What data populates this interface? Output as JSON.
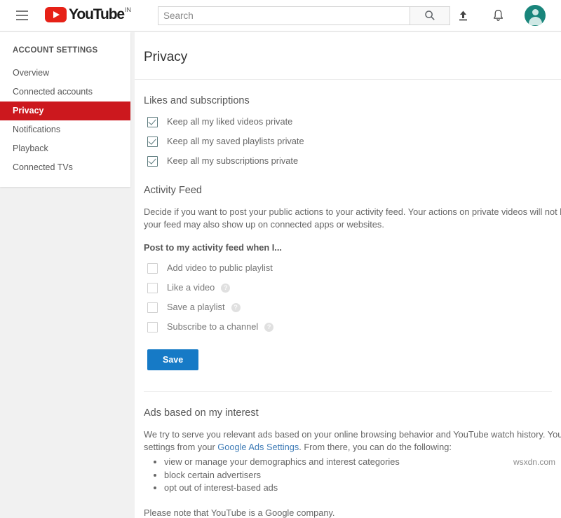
{
  "header": {
    "menu_icon": "hamburger-menu-icon",
    "logo_text": "YouTube",
    "logo_country_code": "IN",
    "search_placeholder": "Search",
    "search_value": "",
    "search_button_icon": "search-icon",
    "upload_icon": "upload-icon",
    "notifications_icon": "bell-icon",
    "avatar_icon": "account-avatar",
    "brand_red": "#e62117",
    "avatar_color": "#19857b"
  },
  "sidebar": {
    "heading": "ACCOUNT SETTINGS",
    "active_color": "#cc181e",
    "items": [
      {
        "label": "Overview",
        "active": false
      },
      {
        "label": "Connected accounts",
        "active": false
      },
      {
        "label": "Privacy",
        "active": true
      },
      {
        "label": "Notifications",
        "active": false
      },
      {
        "label": "Playback",
        "active": false
      },
      {
        "label": "Connected TVs",
        "active": false
      }
    ]
  },
  "main": {
    "page_title": "Privacy",
    "likes_section": {
      "title": "Likes and subscriptions",
      "checkboxes": [
        {
          "label": "Keep all my liked videos private",
          "checked": true
        },
        {
          "label": "Keep all my saved playlists private",
          "checked": true
        },
        {
          "label": "Keep all my subscriptions private",
          "checked": true
        }
      ]
    },
    "activity_section": {
      "title": "Activity Feed",
      "description": "Decide if you want to post your public actions to your activity feed. Your actions on private videos will not be posted. Your actions on your feed may also show up on connected apps or websites.",
      "sub_label": "Post to my activity feed when I...",
      "checkboxes": [
        {
          "label": "Add video to public playlist",
          "checked": false,
          "help": false
        },
        {
          "label": "Like a video",
          "checked": false,
          "help": true
        },
        {
          "label": "Save a playlist",
          "checked": false,
          "help": true
        },
        {
          "label": "Subscribe to a channel",
          "checked": false,
          "help": true
        }
      ],
      "help_glyph": "?",
      "save_label": "Save",
      "save_color": "#167ac6"
    },
    "ads_section": {
      "title": "Ads based on my interest",
      "paragraph_before_link": "We try to serve you relevant ads based on your online browsing behavior and YouTube watch history. You can manage your ads settings from your ",
      "link_text": "Google Ads Settings",
      "paragraph_after_link": ". From there, you can do the following:",
      "bullets": [
        "view or manage your demographics and interest categories",
        "block certain advertisers",
        "opt out of interest-based ads"
      ],
      "note": "Please note that YouTube is a Google company."
    }
  },
  "watermark": "wsxdn.com"
}
